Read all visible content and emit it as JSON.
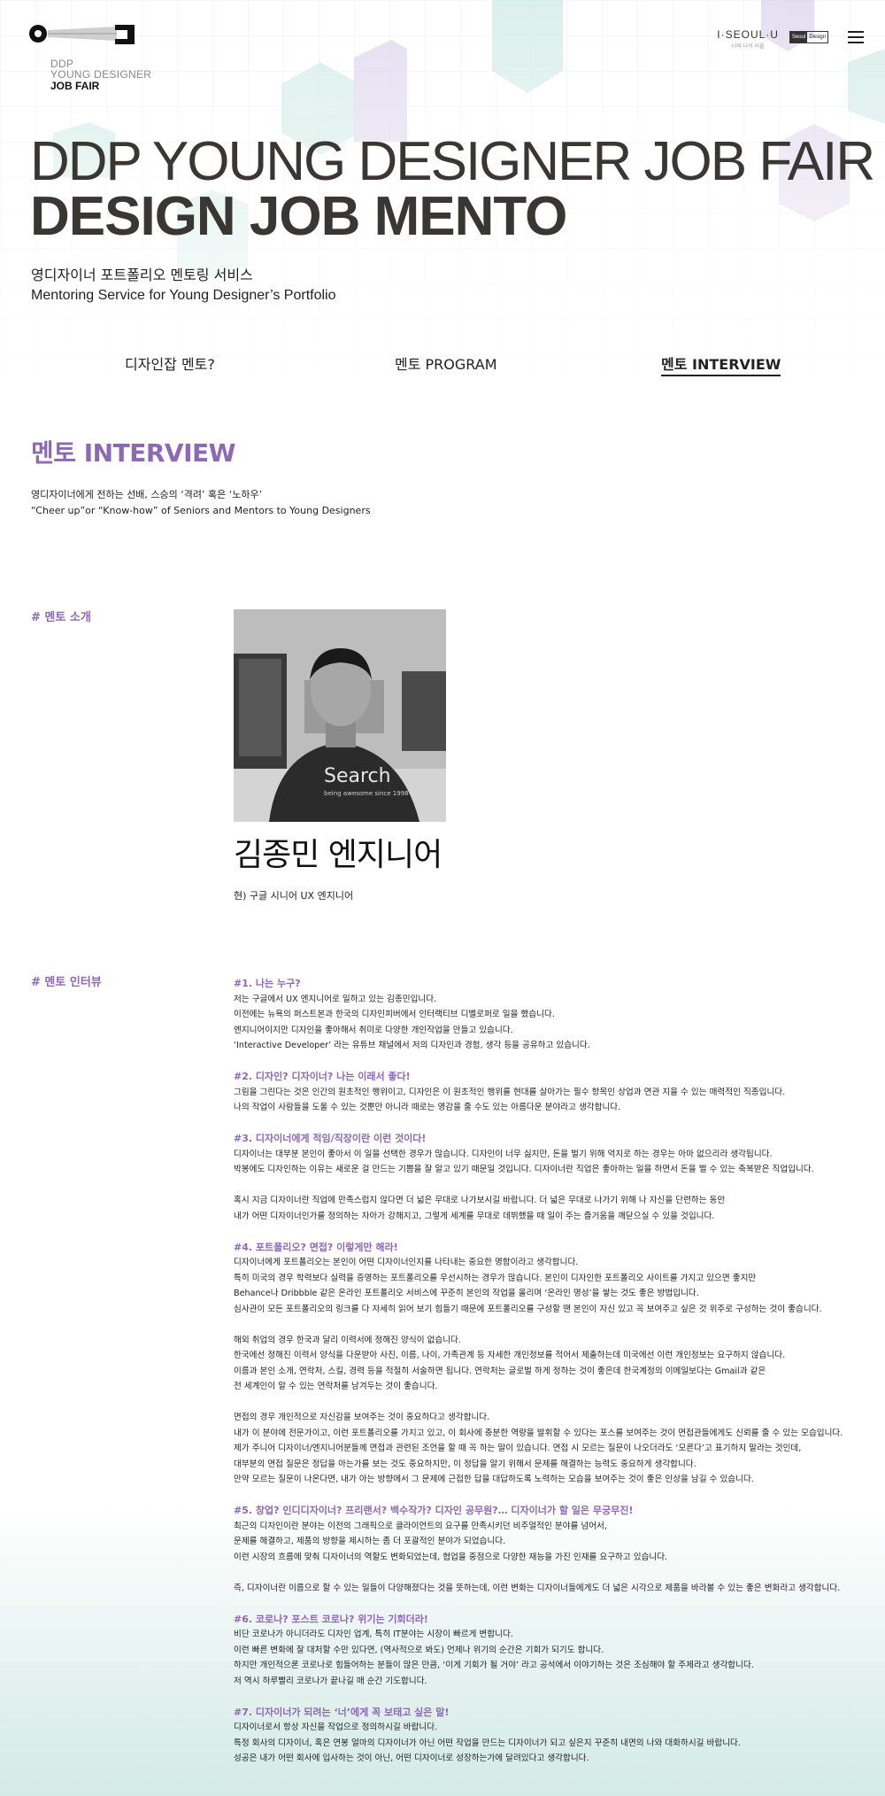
{
  "header": {
    "logo": {
      "line1": "DDP",
      "line2": "YOUNG DESIGNER",
      "line3": "JOB FAIR"
    },
    "seoul_brand": "I·SEOUL·U",
    "seoul_sub": "너와 나의 서울",
    "badge_left": "Seoul",
    "badge_right": "Design",
    "menu_icon": "hamburger-icon"
  },
  "hero": {
    "title_line1": "DDP YOUNG DESIGNER JOB FAIR",
    "title_line2": "DESIGN JOB MENTO",
    "subtitle_ko": "영디자이너 포트폴리오 멘토링 서비스",
    "subtitle_en": "Mentoring Service for Young Designer’s Portfolio"
  },
  "tabs": [
    {
      "label": "디자인잡 멘토?",
      "active": false
    },
    {
      "label": "멘토 PROGRAM",
      "active": false
    },
    {
      "label": "멘토 INTERVIEW",
      "active": true
    }
  ],
  "section": {
    "title": "멘토 INTERVIEW",
    "desc_ko": "영디자이너에게 전하는 선배, 스승의 ‘격려’ 혹은 ‘노하우’",
    "desc_en": "“Cheer up”or “Know-how” of Seniors and Mentors to Young Designers"
  },
  "mentor": {
    "label": "# 멘토 소개",
    "name": "김종민 엔지니어",
    "role": "현) 구글 시니어 UX 엔지니어",
    "shirt_text": "Search",
    "shirt_subtext": "being awesome since 1998"
  },
  "interview": {
    "label": "# 멘토 인터뷰",
    "blocks": [
      {
        "q": "#1. 나는 누구?",
        "lines": [
          "저는 구글에서 UX 엔지니어로 일하고 있는 김종민입니다.",
          "이전에는 뉴욕의 퍼스트본과 한국의 디자인피버에서 인터랙티브 디벨로퍼로 일을 했습니다.",
          "엔지니어이지만 디자인을 좋아해서 취미로 다양한 개인작업을 만들고 있습니다.",
          "‘Interactive Developer’ 라는 유튜브 채널에서 저의 디자인과 경험, 생각 등을 공유하고 있습니다."
        ]
      },
      {
        "q": "#2. 디자인? 디자이너? 나는 이래서 좋다!",
        "lines": [
          "그림을 그린다는 것은 인간의 원초적인 행위이고, 디자인은 이 원초적인 행위를 현대를 살아가는 필수 항목인 상업과 연관 지을 수 있는 매력적인 직종입니다.",
          "나의 작업이 사람들을 도울 수 있는 것뿐만 아니라 때로는 영감을 줄 수도 있는 아름다운 분야라고 생각합니다."
        ]
      },
      {
        "q": "#3. 디자이너에게 적임/직장이란 이런 것이다!",
        "lines": [
          "디자이너는 대부분 본인이 좋아서 이 일을 선택한 경우가 많습니다. 디자인이 너무 싫지만, 돈을 벌기 위해 억지로 하는 경우는 아마 없으리라 생각됩니다.",
          "박봉에도 디자인하는 이유는 새로운 걸 만드는 기쁨을 잘 알고 있기 때문일 것입니다. 디자이너란 직업은 좋아하는 일을 하면서 돈을 벌 수 있는 축복받은 직업입니다.",
          "",
          "혹시 지금 디자이너란 직업에 만족스럽지 않다면 더 넓은 무대로 나가보시길 바랍니다. 더 넓은 무대로 나가기 위해 나 자신을 단련하는 동안",
          "내가 어떤 디자이너인가를 정의하는 자아가 강해지고, 그렇게 세계를 무대로 데뷔했을 때 일이 주는 즐거움을 깨닫으실 수 있을 것입니다."
        ]
      },
      {
        "q": "#4. 포트폴리오? 면접? 이렇게만 해라!",
        "lines": [
          "디자이너에게 포트폴리오는 본인이 어떤 디자이너인지를 나타내는 중요한 명함이라고 생각합니다.",
          "특히 미국의 경우 학력보다 실력을 증명하는 포트폴리오를 우선시하는 경우가 많습니다. 본인이 디자인한 포트폴리오 사이트를 가지고 있으면 좋지만",
          "Behance나 Dribbble 같은 온라인 포트폴리오 서비스에 꾸준히 본인의 작업을 올리며 ‘온라인 명성’을 쌓는 것도 좋은 방법입니다.",
          "심사관이 모든 포트폴리오의 링크를 다 자세히 읽어 보기 힘들기 때문에 포트폴리오를 구성할 땐 본인이 자신 있고 꼭 보여주고 싶은 것 위주로 구성하는 것이 좋습니다.",
          "",
          "해외 취업의 경우 한국과 달리 이력서에 정해진 양식이 없습니다.",
          "한국에선 정해진 이력서 양식을 다운받아 사진, 이름, 나이, 가족관계 등 자세한 개인정보를 적어서 제출하는데 미국에선 이런 개인정보는 요구하지 않습니다.",
          "이름과 본인 소개, 연락처, 스킬, 경력 등을 적절히 서술하면 됩니다. 연락처는 글로벌 하게 정하는 것이 좋은데 한국계정의 이메일보다는 Gmail과 같은",
          "전 세계인이 알 수 있는 연락처를 남겨두는 것이 좋습니다.",
          "",
          "면접의 경우 개인적으로 자신감을 보여주는 것이 중요하다고 생각합니다.",
          "내가 이 분야에 전문가이고, 이런 포트폴리오를 가지고 있고, 이 회사에 충분한 역량을 발휘할 수 있다는 포스를 보여주는 것이 면접관들에게도 신뢰를 줄 수 있는 모습입니다.",
          "제가 주니어 디자이너/엔지니어분들께 면접과 관련된 조언을 할 때 꼭 하는 말이 있습니다. 면접 시 모르는 질문이 나오더라도 ‘모른다’고 표기하지 말라는 것인데,",
          "대부분의 면접 질문은 정답을 아는가를 보는 것도 중요하지만, 이 정답을 알기 위해서 문제를 해결하는 능력도 중요하게 생각합니다.",
          "만약 모르는 질문이 나온다면, 내가 아는 방향에서 그 문제에 근접한 답을 대답하도록 노력하는 모습을 보여주는 것이 좋은 인상을 남길 수 있습니다."
        ]
      },
      {
        "q": "#5. 창업? 인디디자이너? 프리랜서? 백수작가? 디자인 공무원?… 디자이너가 할 일은 무궁무진!",
        "lines": [
          "최근의 디자인이란 분야는 이전의 그래픽으로 클라이언트의 요구를 만족시키던 비주얼적인 분야를 넘어서,",
          "문제를 해결하고, 제품의 방향을 제시하는 좀 더 포괄적인 분야가 되었습니다.",
          "이런 시장의 흐름에 맞춰 디자이너의 역할도 변화되었는데, 협업을 중점으로 다양한 재능을 가진 인재를 요구하고 있습니다.",
          "",
          "즉, 디자이너란 이름으로 할 수 있는 일들이 다양해졌다는 것을 뜻하는데, 이런 변화는 디자이너들에게도 더 넓은 시각으로 제품을 바라볼 수 있는 좋은 변화라고 생각합니다."
        ]
      },
      {
        "q": "#6. 코로나? 포스트 코로나? 위기는 기회더라!",
        "lines": [
          "비단 코로나가 아니더라도 디자인 업계, 특히 IT분야는 시장이 빠르게 변합니다.",
          "이런 빠른 변화에 잘 대처할 수만 있다면, (역사적으로 봐도) 언제나 위기의 순간은 기회가 되기도 합니다.",
          "하지만 개인적으론 코로나로 힘들어하는 분들이 많은 만큼, ‘이게 기회가 될 거야’ 라고 공석에서 이야기하는 것은 조심해야 할 주제라고 생각합니다.",
          "저 역시 하루빨리 코로나가 끝나길 매 순간 기도합니다."
        ]
      },
      {
        "q": "#7. 디자이너가 되려는 ‘너’에게 꼭 보태고 싶은 말!",
        "lines": [
          "디자이너로서 항상 자신을 작업으로 정의하시길 바랍니다.",
          "특정 회사의 디자이너, 혹은 연봉 얼마의 디자이너가 아닌 어떤 작업을 만드는 디자이너가 되고 싶은지 꾸준히 내면의 나와 대화하시길 바랍니다.",
          "성공은 내가 어떤 회사에 입사하는 것이 아닌, 어떤 디자이너로 성장하는가에 달려있다고 생각합니다."
        ]
      }
    ]
  },
  "colors": {
    "accent": "#8d68b4",
    "hero_text": "#3a3633",
    "hex_teal": "#a9d8cd",
    "hex_lilac": "#c8bde0"
  }
}
